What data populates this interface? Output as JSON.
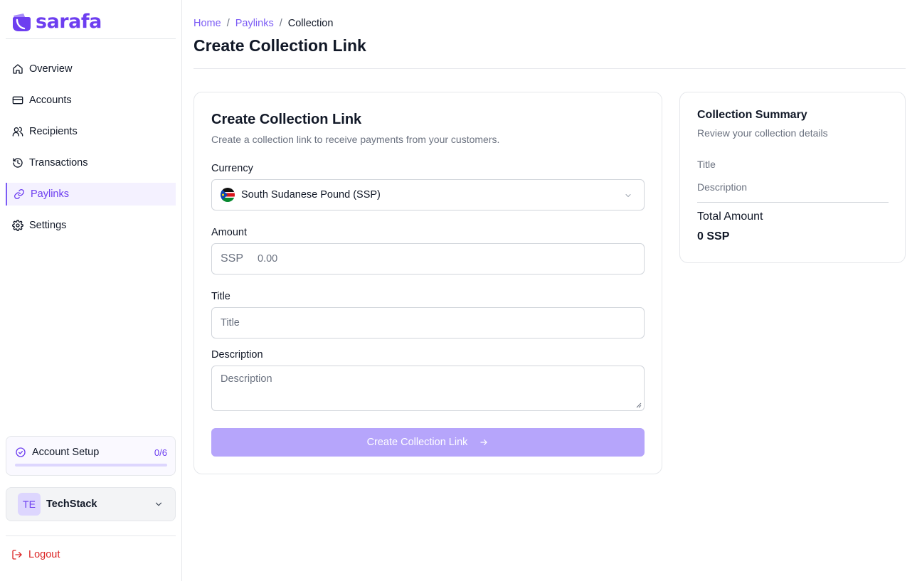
{
  "brand": {
    "name": "sarafa",
    "color": "#6d3ef0"
  },
  "sidebar": {
    "items": [
      {
        "label": "Overview",
        "icon": "home-icon"
      },
      {
        "label": "Accounts",
        "icon": "credit-card-icon"
      },
      {
        "label": "Recipients",
        "icon": "users-icon"
      },
      {
        "label": "Transactions",
        "icon": "history-icon"
      },
      {
        "label": "Paylinks",
        "icon": "link-icon",
        "active": true
      },
      {
        "label": "Settings",
        "icon": "gear-icon"
      }
    ],
    "setup": {
      "label": "Account Setup",
      "count": "0/6",
      "progress": 0
    },
    "org": {
      "initials": "TE",
      "name": "TechStack"
    },
    "logout_label": "Logout"
  },
  "breadcrumb": {
    "home": "Home",
    "sep1": "/",
    "paylinks": "Paylinks",
    "sep2": "/",
    "current": "Collection"
  },
  "page_title": "Create Collection Link",
  "form": {
    "title": "Create Collection Link",
    "subtitle": "Create a collection link to receive payments from your customers.",
    "currency_label": "Currency",
    "currency_value": "South Sudanese Pound (SSP)",
    "amount_label": "Amount",
    "amount_prefix": "SSP",
    "amount_placeholder": "0.00",
    "title_label": "Title",
    "title_placeholder": "Title",
    "description_label": "Description",
    "description_placeholder": "Description",
    "submit_label": "Create Collection Link"
  },
  "summary": {
    "title": "Collection Summary",
    "subtitle": "Review your collection details",
    "title_field": "Title",
    "description_field": "Description",
    "total_label": "Total Amount",
    "total_value": "0 SSP"
  }
}
